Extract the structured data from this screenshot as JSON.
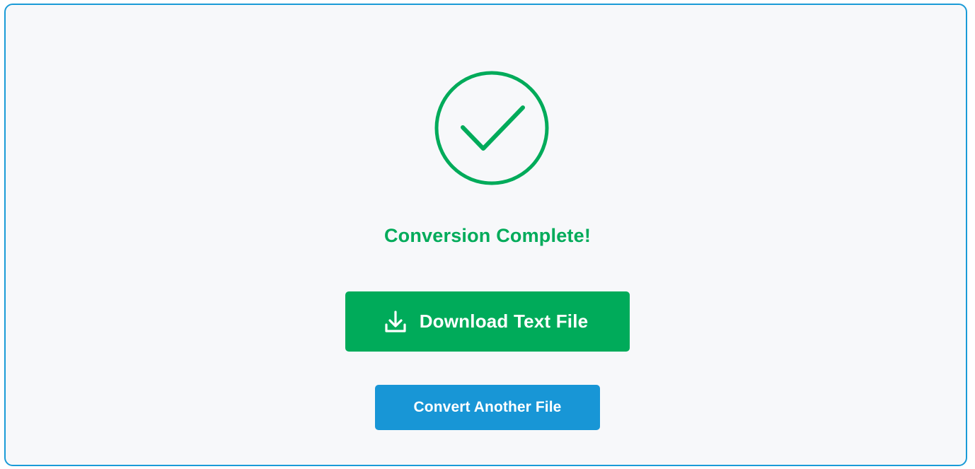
{
  "status": {
    "icon": "check-circle-icon",
    "title": "Conversion Complete!"
  },
  "actions": {
    "download_label": "Download Text File",
    "download_icon": "download-icon",
    "convert_another_label": "Convert Another File"
  },
  "colors": {
    "success": "#00ab5a",
    "primary": "#1896d6",
    "panel_border": "#1a9bd7",
    "panel_background": "#f7f8fa"
  }
}
